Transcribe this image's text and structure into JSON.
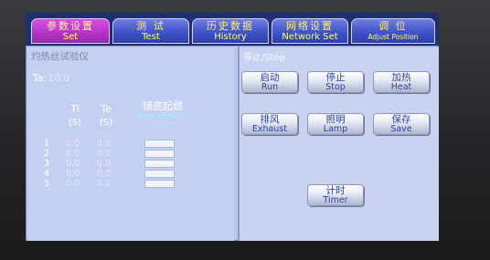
{
  "tabs": [
    {
      "cn": "参数设置",
      "en": "Set",
      "active": true
    },
    {
      "cn": "测 试",
      "en": "Test",
      "active": false
    },
    {
      "cn": "历史数据",
      "en": "History",
      "active": false
    },
    {
      "cn": "网络设置",
      "en": "Network Set",
      "active": false
    },
    {
      "cn": "调 位",
      "en": "Adjust Position",
      "active": false
    }
  ],
  "left": {
    "title": "灼热丝试验仪",
    "ta_label": "Ta:",
    "ta_value": "10.0",
    "col_ti": {
      "label": "Ti",
      "unit": "(S)"
    },
    "col_te": {
      "label": "Te",
      "unit": "(S)"
    },
    "col_ignite": {
      "cn": "铺底起燃",
      "en1": "Bottom material",
      "en2": "ignite"
    },
    "rows": [
      {
        "n": "1",
        "ti": "0.0",
        "te": "0.0"
      },
      {
        "n": "2",
        "ti": "0.0",
        "te": "0.0"
      },
      {
        "n": "3",
        "ti": "0.0",
        "te": "0.0"
      },
      {
        "n": "4",
        "ti": "0.0",
        "te": "0.0"
      },
      {
        "n": "5",
        "ti": "0.0",
        "te": "0.0"
      }
    ]
  },
  "right": {
    "status": "停止/Stop",
    "buttons": {
      "run": {
        "cn": "启动",
        "en": "Run"
      },
      "stop": {
        "cn": "停止",
        "en": "Stop"
      },
      "heat": {
        "cn": "加热",
        "en": "Heat"
      },
      "exhaust": {
        "cn": "排风",
        "en": "Exhaust"
      },
      "lamp": {
        "cn": "照明",
        "en": "Lamp"
      },
      "save": {
        "cn": "保存",
        "en": "Save"
      },
      "timer": {
        "cn": "计时",
        "en": "Timer"
      }
    }
  },
  "colors": {
    "tab_active": "#b433c4",
    "tab_inactive": "#4054c8",
    "screen_bg": "#b9c7ee",
    "button_text": "#2f40a3"
  }
}
